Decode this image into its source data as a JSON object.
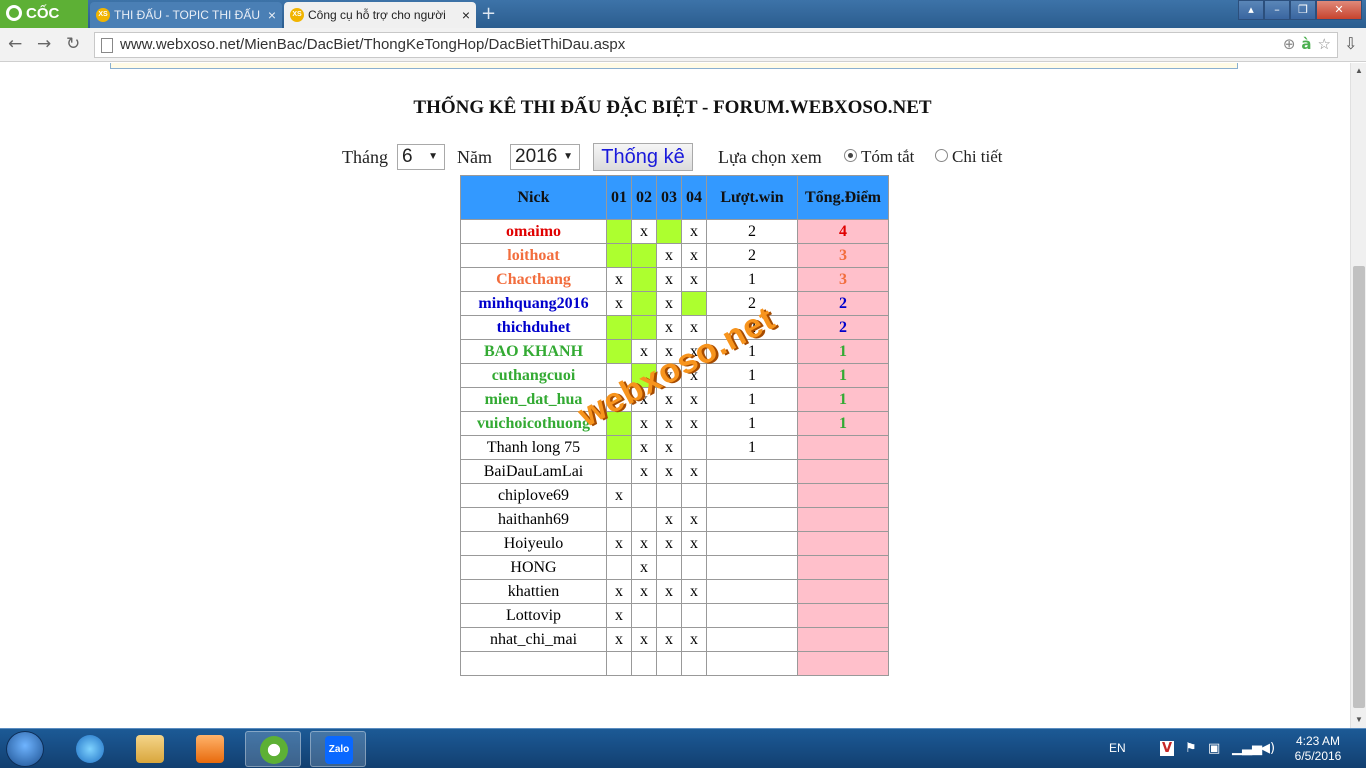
{
  "browser": {
    "brand": "CỐC CỐC",
    "tabs": [
      {
        "label": "THI ĐẤU - TOPIC THI ĐẤU",
        "favicon": "XS",
        "active": false
      },
      {
        "label": "Công cụ hỗ trợ cho người",
        "favicon": "XS",
        "active": true
      }
    ],
    "url": "www.webxoso.net/MienBac/DacBiet/ThongKeTongHop/DacBietThiDau.aspx"
  },
  "page": {
    "title": "THỐNG KÊ THI ĐẤU ĐẶC BIỆT - FORUM.WEBXOSO.NET",
    "filters": {
      "month_label": "Tháng",
      "month_value": "6",
      "year_label": "Năm",
      "year_value": "2016",
      "submit_label": "Thống kê",
      "view_label": "Lựa chọn xem",
      "option_summary": "Tóm tắt",
      "option_detail": "Chi tiết",
      "selected_view": "Tóm tắt"
    },
    "table": {
      "headers": [
        "Nick",
        "01",
        "02",
        "03",
        "04",
        "Lượt.win",
        "Tổng.Điểm"
      ],
      "rows": [
        {
          "nick": "omaimo",
          "color": "#e00000",
          "d": [
            "G",
            "x",
            "G",
            "x"
          ],
          "win": "2",
          "points": "4"
        },
        {
          "nick": "loithoat",
          "color": "#f26d3d",
          "d": [
            "G",
            "G",
            "x",
            "x"
          ],
          "win": "2",
          "points": "3"
        },
        {
          "nick": "Chacthang",
          "color": "#f26d3d",
          "d": [
            "x",
            "G",
            "x",
            "x"
          ],
          "win": "1",
          "points": "3"
        },
        {
          "nick": "minhquang2016",
          "color": "#0000cc",
          "d": [
            "x",
            "G",
            "x",
            "G"
          ],
          "win": "2",
          "points": "2"
        },
        {
          "nick": "thichduhet",
          "color": "#0000cc",
          "d": [
            "G",
            "G",
            "x",
            "x"
          ],
          "win": "2",
          "points": "2"
        },
        {
          "nick": "BAO KHANH",
          "color": "#33aa33",
          "d": [
            "G",
            "x",
            "x",
            "x"
          ],
          "win": "1",
          "points": "1"
        },
        {
          "nick": "cuthangcuoi",
          "color": "#33aa33",
          "d": [
            "",
            "G",
            "x",
            "x"
          ],
          "win": "1",
          "points": "1"
        },
        {
          "nick": "mien_dat_hua",
          "color": "#33aa33",
          "d": [
            "",
            "x",
            "x",
            "x"
          ],
          "win": "1",
          "points": "1"
        },
        {
          "nick": "vuichoicothuong",
          "color": "#33aa33",
          "d": [
            "G",
            "x",
            "x",
            "x"
          ],
          "win": "1",
          "points": "1"
        },
        {
          "nick": "Thanh long 75",
          "color": "",
          "d": [
            "G",
            "x",
            "x",
            ""
          ],
          "win": "1",
          "points": ""
        },
        {
          "nick": "BaiDauLamLai",
          "color": "",
          "d": [
            "",
            "x",
            "x",
            "x"
          ],
          "win": "",
          "points": ""
        },
        {
          "nick": "chiplove69",
          "color": "",
          "d": [
            "x",
            "",
            "",
            ""
          ],
          "win": "",
          "points": ""
        },
        {
          "nick": "haithanh69",
          "color": "",
          "d": [
            "",
            "",
            "x",
            "x"
          ],
          "win": "",
          "points": ""
        },
        {
          "nick": "Hoiyeulo",
          "color": "",
          "d": [
            "x",
            "x",
            "x",
            "x"
          ],
          "win": "",
          "points": ""
        },
        {
          "nick": "HONG",
          "color": "",
          "d": [
            "",
            "x",
            "",
            ""
          ],
          "win": "",
          "points": ""
        },
        {
          "nick": "khattien",
          "color": "",
          "d": [
            "x",
            "x",
            "x",
            "x"
          ],
          "win": "",
          "points": ""
        },
        {
          "nick": "Lottovip",
          "color": "",
          "d": [
            "x",
            "",
            "",
            ""
          ],
          "win": "",
          "points": ""
        },
        {
          "nick": "nhat_chi_mai",
          "color": "",
          "d": [
            "x",
            "x",
            "x",
            "x"
          ],
          "win": "",
          "points": ""
        },
        {
          "nick": "",
          "color": "",
          "d": [
            "",
            "",
            "",
            ""
          ],
          "win": "",
          "points": ""
        }
      ]
    },
    "watermark": "webxoso.net"
  },
  "taskbar": {
    "apps": [
      "ie-icon",
      "explorer-icon",
      "media-player-icon",
      "coccoc-icon",
      "zalo-icon"
    ],
    "zalo_label": "Zalo",
    "lang": "EN",
    "time": "4:23 AM",
    "date": "6/5/2016"
  },
  "colors": {
    "header_blue": "#3399ff",
    "win_green": "#adff2f",
    "points_pink": "#ffc0cb"
  }
}
